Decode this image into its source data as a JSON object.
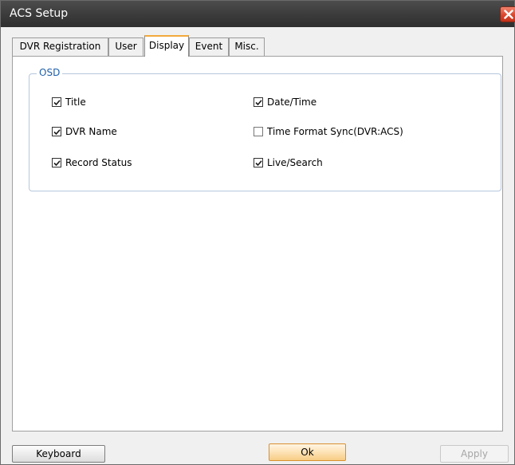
{
  "window": {
    "title": "ACS Setup"
  },
  "tabs": [
    {
      "label": "DVR Registration",
      "active": false
    },
    {
      "label": "User",
      "active": false
    },
    {
      "label": "Display",
      "active": true
    },
    {
      "label": "Event",
      "active": false
    },
    {
      "label": "Misc.",
      "active": false
    }
  ],
  "osd": {
    "legend": "OSD",
    "options": {
      "title": {
        "label": "Title",
        "checked": true
      },
      "date_time": {
        "label": "Date/Time",
        "checked": true
      },
      "dvr_name": {
        "label": "DVR Name",
        "checked": true
      },
      "time_format_sync": {
        "label": "Time Format Sync(DVR:ACS)",
        "checked": false
      },
      "record_status": {
        "label": "Record Status",
        "checked": true
      },
      "live_search": {
        "label": "Live/Search",
        "checked": true
      }
    }
  },
  "buttons": {
    "keyboard": "Keyboard",
    "ok": "Ok",
    "apply": "Apply"
  },
  "colors": {
    "title_bar": "#3c3c3c",
    "close_button": "#d8472d",
    "active_tab_accent": "#f2a93b",
    "group_legend": "#1f5fa8",
    "group_border": "#b5c7dd",
    "ok_button": "#fde2b5"
  },
  "icons": {
    "close": "close-x-icon",
    "checkmark": "checkmark-icon"
  }
}
